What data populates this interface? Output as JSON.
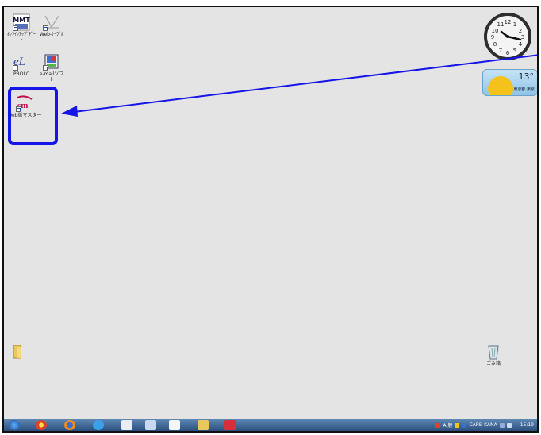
{
  "desktop_icons": [
    {
      "label": "ｵﾝﾗｲﾝｱｯﾌﾟﾃﾞｰﾄ",
      "icon": "mmt-icon"
    },
    {
      "label": "Web-ｹｰﾌﾞﾙ",
      "icon": "placeholder-icon"
    },
    {
      "label": "PROLC",
      "icon": "el-icon"
    },
    {
      "label": "e-mailソフト",
      "icon": "email-app-icon"
    },
    {
      "label": "Web版マスター",
      "icon": "sm-app-icon"
    },
    {
      "label": "",
      "icon": "folder-icon"
    },
    {
      "label": "ごみ箱",
      "icon": "recycle-bin-icon"
    }
  ],
  "clock": {
    "numerals": [
      "12",
      "1",
      "2",
      "3",
      "4",
      "5",
      "6",
      "7",
      "8",
      "9",
      "10",
      "11"
    ]
  },
  "weather": {
    "temperature": "13°",
    "location": "東京都 東京"
  },
  "tray": {
    "time": "15:19",
    "ime": "A 般",
    "lang": "CAPS",
    "status": "KANA"
  },
  "accent_color": "#1515e8"
}
